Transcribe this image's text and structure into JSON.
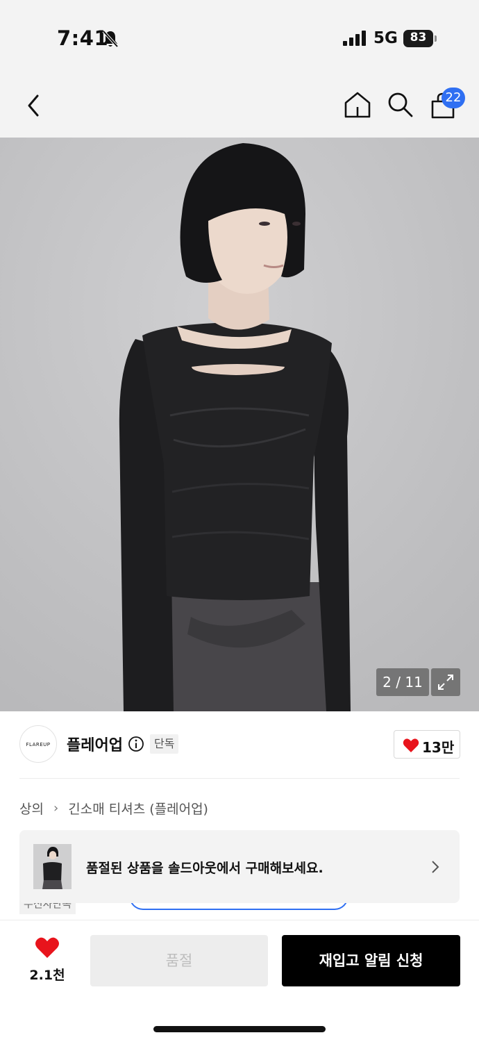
{
  "status_bar": {
    "time": "7:41",
    "network": "5G",
    "battery": "83",
    "icons": [
      "bell-slash-icon",
      "signal-icon",
      "battery-icon"
    ]
  },
  "nav": {
    "icons": [
      "back-icon",
      "home-icon",
      "search-icon",
      "cart-icon"
    ],
    "cart_badge": "22"
  },
  "gallery": {
    "counter": "2 / 11",
    "icons": [
      "expand-icon"
    ]
  },
  "brand": {
    "logo_text": "FLAREUP",
    "name": "플레어업",
    "badge": "단독",
    "like_count": "13만"
  },
  "breadcrumb": {
    "category": "상의",
    "subcategory": "긴소매 티셔츠 (플레어업)"
  },
  "banner": {
    "text": "품절된 상품을 솔드아웃에서 구매해보세요."
  },
  "peek": {
    "tag": "무신사단독"
  },
  "bottom_bar": {
    "wish_count": "2.1천",
    "soldout_label": "품절",
    "restock_label": "재입고 알림 신청"
  },
  "colors": {
    "accent_blue": "#2f6ff2",
    "heart_red": "#e8141c",
    "cta_black": "#000000"
  }
}
